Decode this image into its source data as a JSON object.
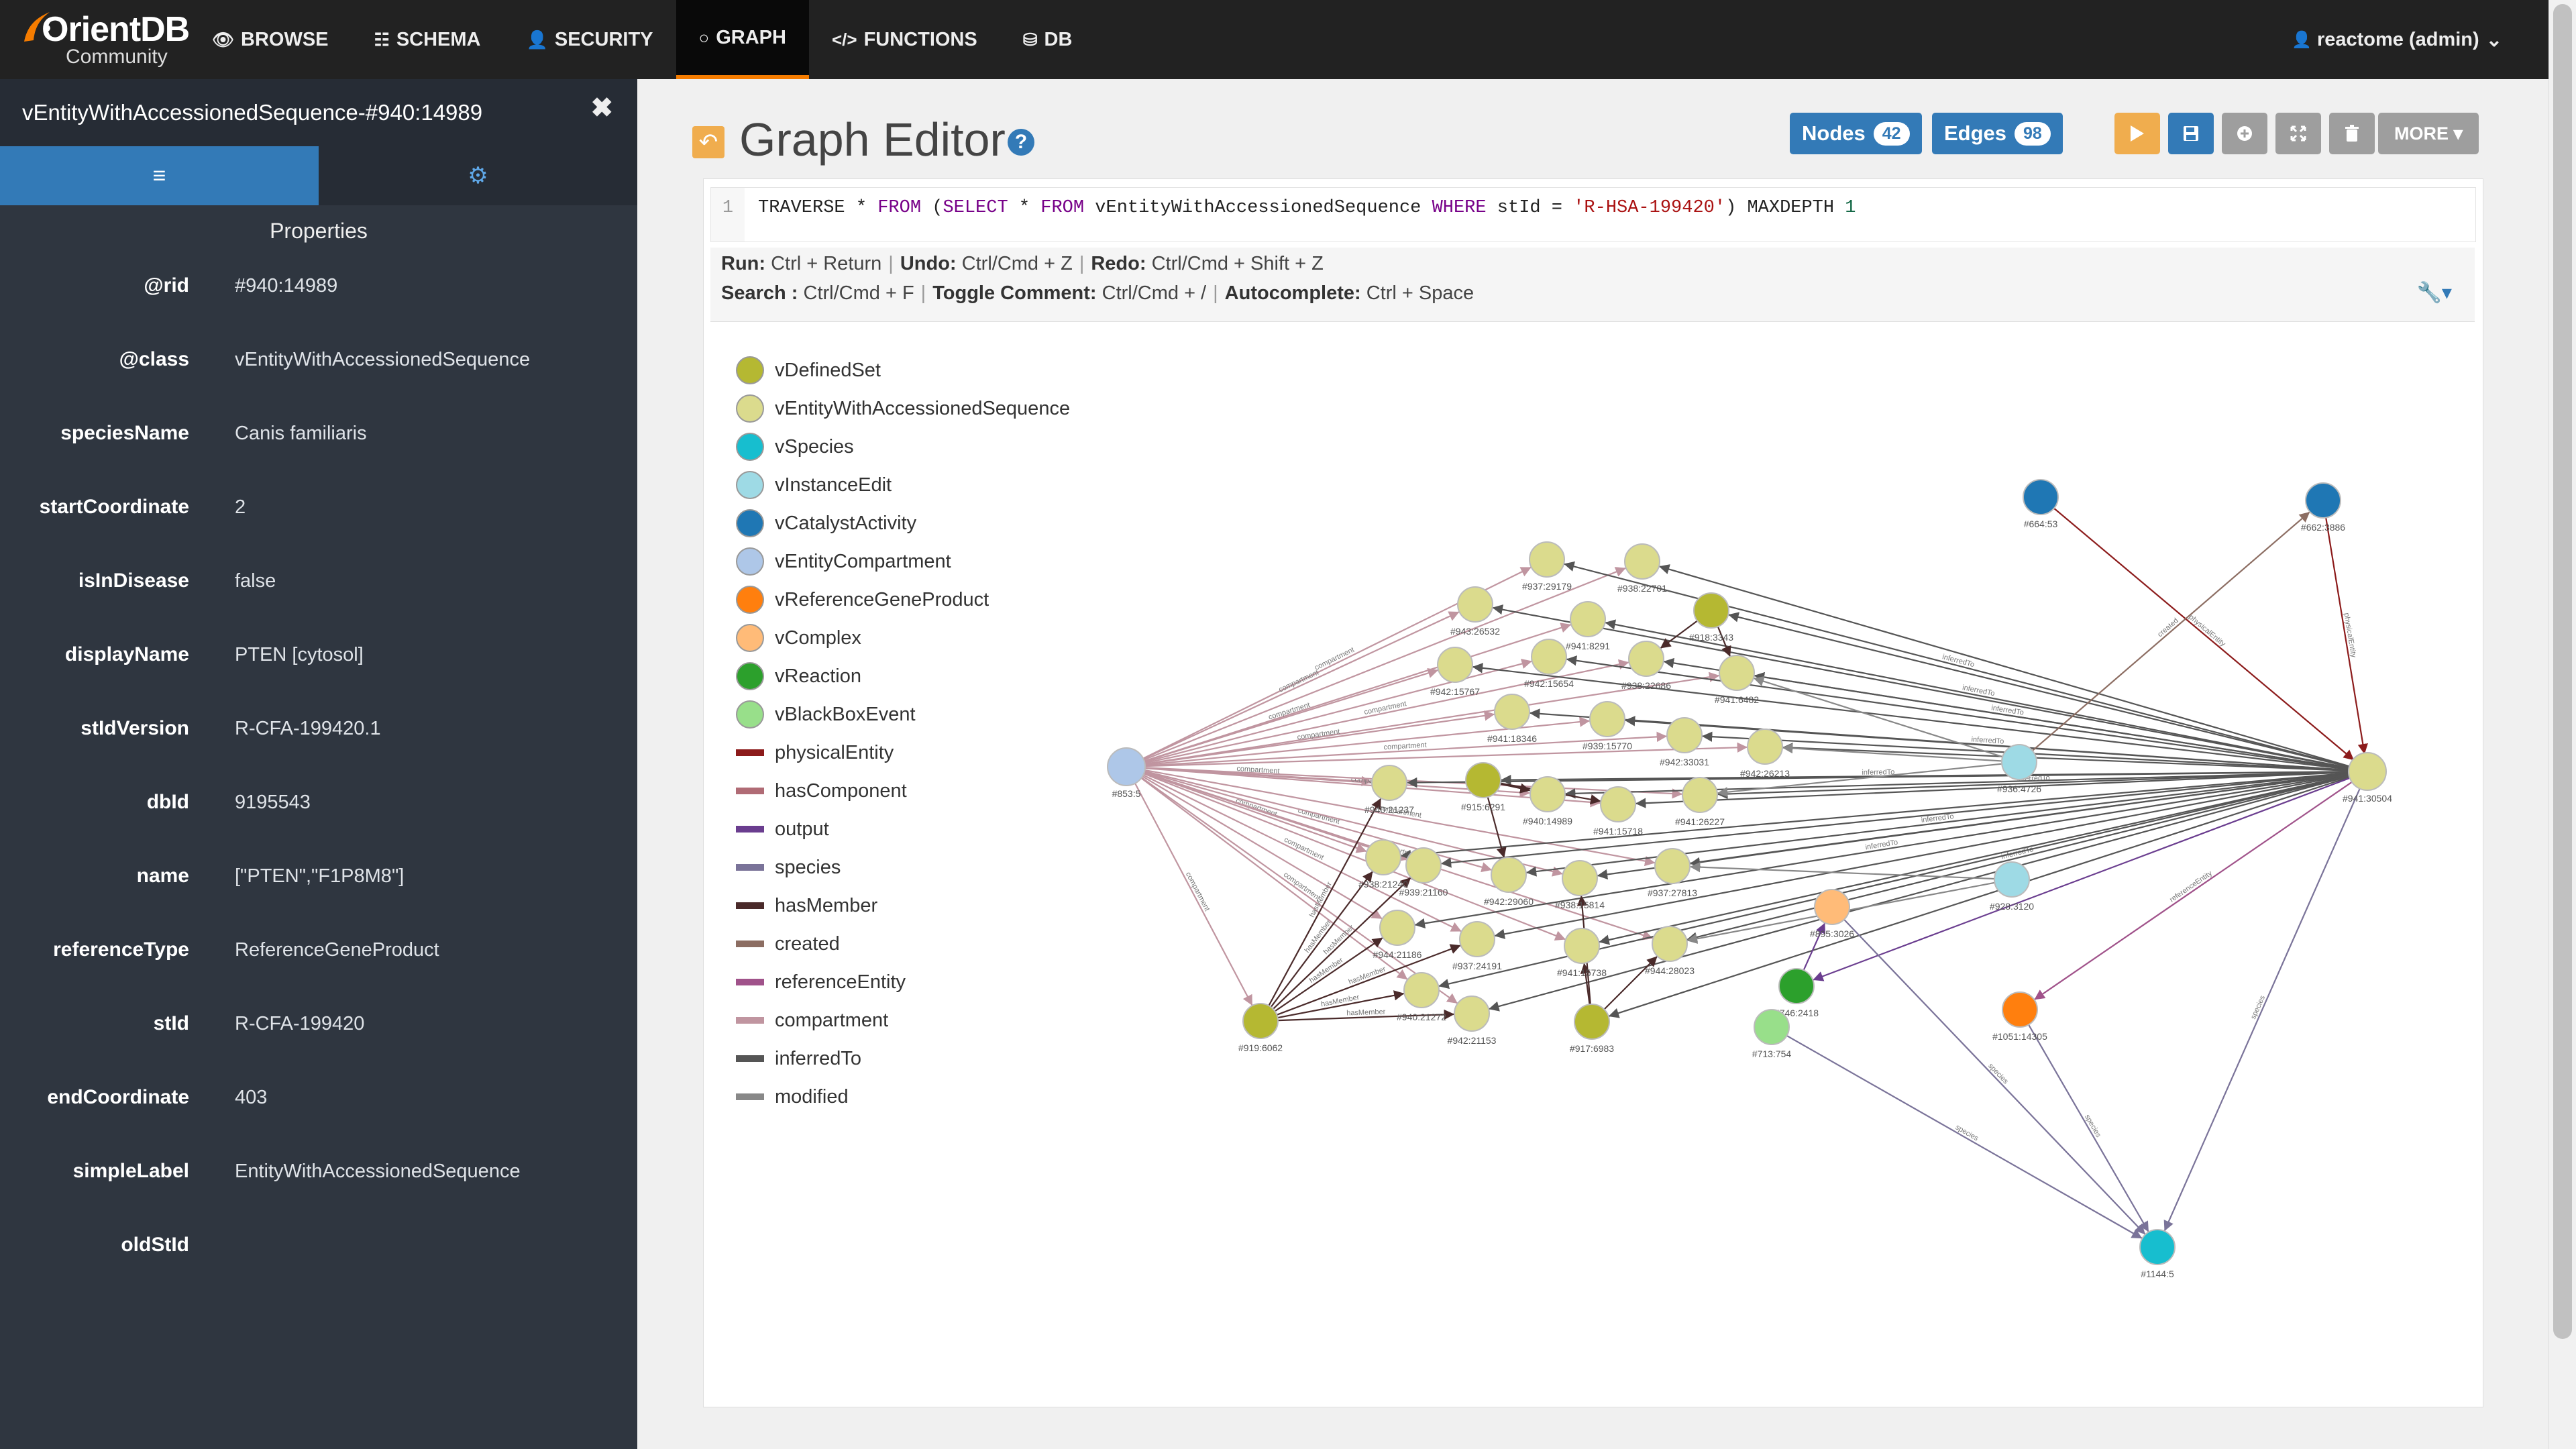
{
  "app": {
    "logo_main": "OrientDB",
    "logo_sub": "Community"
  },
  "nav": [
    {
      "icon": "👁",
      "label": "BROWSE"
    },
    {
      "icon": "☷",
      "label": "SCHEMA"
    },
    {
      "icon": "👤",
      "label": "SECURITY"
    },
    {
      "icon": "○",
      "label": "GRAPH"
    },
    {
      "icon": "</>",
      "label": "FUNCTIONS"
    },
    {
      "icon": "⛁",
      "label": "DB"
    }
  ],
  "user": {
    "label": "reactome (admin)",
    "caret": "⌄",
    "icon": "👤"
  },
  "side": {
    "title": "vEntityWithAccessionedSequence-#940:14989",
    "close": "✖",
    "tab_props_icon": "≡",
    "tab_settings_icon": "⚙",
    "section": "Properties",
    "properties": [
      {
        "key": "@rid",
        "value": "#940:14989"
      },
      {
        "key": "@class",
        "value": "vEntityWithAccessionedSequence"
      },
      {
        "key": "speciesName",
        "value": "Canis familiaris"
      },
      {
        "key": "startCoordinate",
        "value": "2"
      },
      {
        "key": "isInDisease",
        "value": "false"
      },
      {
        "key": "displayName",
        "value": "PTEN [cytosol]"
      },
      {
        "key": "stIdVersion",
        "value": "R-CFA-199420.1"
      },
      {
        "key": "dbId",
        "value": "9195543"
      },
      {
        "key": "name",
        "value": "[\"PTEN\",\"F1P8M8\"]"
      },
      {
        "key": "referenceType",
        "value": "ReferenceGeneProduct"
      },
      {
        "key": "stId",
        "value": "R-CFA-199420"
      },
      {
        "key": "endCoordinate",
        "value": "403"
      },
      {
        "key": "simpleLabel",
        "value": "EntityWithAccessionedSequence"
      },
      {
        "key": "oldStId",
        "value": ""
      }
    ]
  },
  "editor": {
    "title": "Graph Editor",
    "help": "?",
    "back_icon": "↶",
    "nodes_label": "Nodes",
    "nodes_count": "42",
    "edges_label": "Edges",
    "edges_count": "98",
    "more_label": "MORE ▾",
    "line_no": "1",
    "query": {
      "p1": "TRAVERSE * ",
      "k1": "FROM",
      "p2": " (",
      "k2": "SELECT",
      "p3": " * ",
      "k3": "FROM",
      "p4": " vEntityWithAccessionedSequence ",
      "k4": "WHERE",
      "p5": " stId = ",
      "s1": "'R-HSA-199420'",
      "p6": ") MAXDEPTH ",
      "n1": "1"
    },
    "hints1": [
      {
        "k": "Run:",
        "v": "Ctrl + Return"
      },
      {
        "k": "Undo:",
        "v": "Ctrl/Cmd + Z"
      },
      {
        "k": "Redo:",
        "v": "Ctrl/Cmd + Shift + Z"
      }
    ],
    "hints2": [
      {
        "k": "Search :",
        "v": "Ctrl/Cmd + F"
      },
      {
        "k": "Toggle Comment:",
        "v": "Ctrl/Cmd + /"
      },
      {
        "k": "Autocomplete:",
        "v": "Ctrl + Space"
      }
    ],
    "wrench": "🔧▾"
  },
  "legend": {
    "nodes": [
      {
        "name": "vDefinedSet",
        "color": "#b5b832"
      },
      {
        "name": "vEntityWithAccessionedSequence",
        "color": "#dbdb8d"
      },
      {
        "name": "vSpecies",
        "color": "#17becf"
      },
      {
        "name": "vInstanceEdit",
        "color": "#9edae5"
      },
      {
        "name": "vCatalystActivity",
        "color": "#1f77b4"
      },
      {
        "name": "vEntityCompartment",
        "color": "#aec7e8"
      },
      {
        "name": "vReferenceGeneProduct",
        "color": "#ff7f0e"
      },
      {
        "name": "vComplex",
        "color": "#ffbb78"
      },
      {
        "name": "vReaction",
        "color": "#2ca02c"
      },
      {
        "name": "vBlackBoxEvent",
        "color": "#98df8a"
      }
    ],
    "edges": [
      {
        "name": "physicalEntity",
        "color": "#8c1b1b"
      },
      {
        "name": "hasComponent",
        "color": "#b06b75"
      },
      {
        "name": "output",
        "color": "#6a3d8f"
      },
      {
        "name": "species",
        "color": "#7a7399"
      },
      {
        "name": "hasMember",
        "color": "#4a2a2a"
      },
      {
        "name": "created",
        "color": "#8c6d62"
      },
      {
        "name": "referenceEntity",
        "color": "#a0528a"
      },
      {
        "name": "compartment",
        "color": "#c095a0"
      },
      {
        "name": "inferredTo",
        "color": "#555555"
      },
      {
        "name": "modified",
        "color": "#888888"
      }
    ]
  },
  "graph": {
    "hub_left": {
      "label": "#853:5"
    },
    "hub_right": {
      "label": "#941:30504"
    },
    "nodes": [
      {
        "label": "#664:53",
        "type": "vCatalystActivity"
      },
      {
        "label": "#662:3886",
        "type": "vCatalystActivity"
      },
      {
        "label": "#937:29179",
        "type": "vEntityWithAccessionedSequence"
      },
      {
        "label": "#938:22701",
        "type": "vEntityWithAccessionedSequence"
      },
      {
        "label": "#918:3343",
        "type": "vDefinedSet"
      },
      {
        "label": "#943:26532",
        "type": "vEntityWithAccessionedSequence"
      },
      {
        "label": "#941:8291",
        "type": "vEntityWithAccessionedSequence"
      },
      {
        "label": "#942:15767",
        "type": "vEntityWithAccessionedSequence"
      },
      {
        "label": "#942:15654",
        "type": "vEntityWithAccessionedSequence"
      },
      {
        "label": "#938:22686",
        "type": "vEntityWithAccessionedSequence"
      },
      {
        "label": "#941:6482",
        "type": "vEntityWithAccessionedSequence"
      },
      {
        "label": "#941:18346",
        "type": "vEntityWithAccessionedSequence"
      },
      {
        "label": "#939:15770",
        "type": "vEntityWithAccessionedSequence"
      },
      {
        "label": "#942:33031",
        "type": "vEntityWithAccessionedSequence"
      },
      {
        "label": "#942:26213",
        "type": "vEntityWithAccessionedSequence"
      },
      {
        "label": "#936:4726",
        "type": "vInstanceEdit"
      },
      {
        "label": "#940:21237",
        "type": "vEntityWithAccessionedSequence"
      },
      {
        "label": "#915:6291",
        "type": "vDefinedSet"
      },
      {
        "label": "#940:14989",
        "type": "vEntityWithAccessionedSequence"
      },
      {
        "label": "#941:15718",
        "type": "vEntityWithAccessionedSequence"
      },
      {
        "label": "#941:26227",
        "type": "vEntityWithAccessionedSequence"
      },
      {
        "label": "#938:21240",
        "type": "vEntityWithAccessionedSequence"
      },
      {
        "label": "#939:21160",
        "type": "vEntityWithAccessionedSequence"
      },
      {
        "label": "#942:29060",
        "type": "vEntityWithAccessionedSequence"
      },
      {
        "label": "#938:15814",
        "type": "vEntityWithAccessionedSequence"
      },
      {
        "label": "#937:27813",
        "type": "vEntityWithAccessionedSequence"
      },
      {
        "label": "#928:3120",
        "type": "vInstanceEdit"
      },
      {
        "label": "#895:3026",
        "type": "vComplex"
      },
      {
        "label": "#944:21186",
        "type": "vEntityWithAccessionedSequence"
      },
      {
        "label": "#937:24191",
        "type": "vEntityWithAccessionedSequence"
      },
      {
        "label": "#941:15738",
        "type": "vEntityWithAccessionedSequence"
      },
      {
        "label": "#944:28023",
        "type": "vEntityWithAccessionedSequence"
      },
      {
        "label": "#746:2418",
        "type": "vReaction"
      },
      {
        "label": "#1051:14305",
        "type": "vReferenceGeneProduct"
      },
      {
        "label": "#919:6062",
        "type": "vDefinedSet"
      },
      {
        "label": "#940:21272",
        "type": "vEntityWithAccessionedSequence"
      },
      {
        "label": "#942:21153",
        "type": "vEntityWithAccessionedSequence"
      },
      {
        "label": "#917:6983",
        "type": "vDefinedSet"
      },
      {
        "label": "#713:754",
        "type": "vBlackBoxEvent"
      },
      {
        "label": "#1144:5",
        "type": "vSpecies"
      }
    ],
    "edge_labels": {
      "compartment": "compartment",
      "hasMember": "hasMember",
      "inferredTo": "inferredTo",
      "species": "species",
      "physicalEntity": "physicalEntity",
      "created": "created",
      "referenceEntity": "referenceEntity",
      "output": "output"
    }
  }
}
